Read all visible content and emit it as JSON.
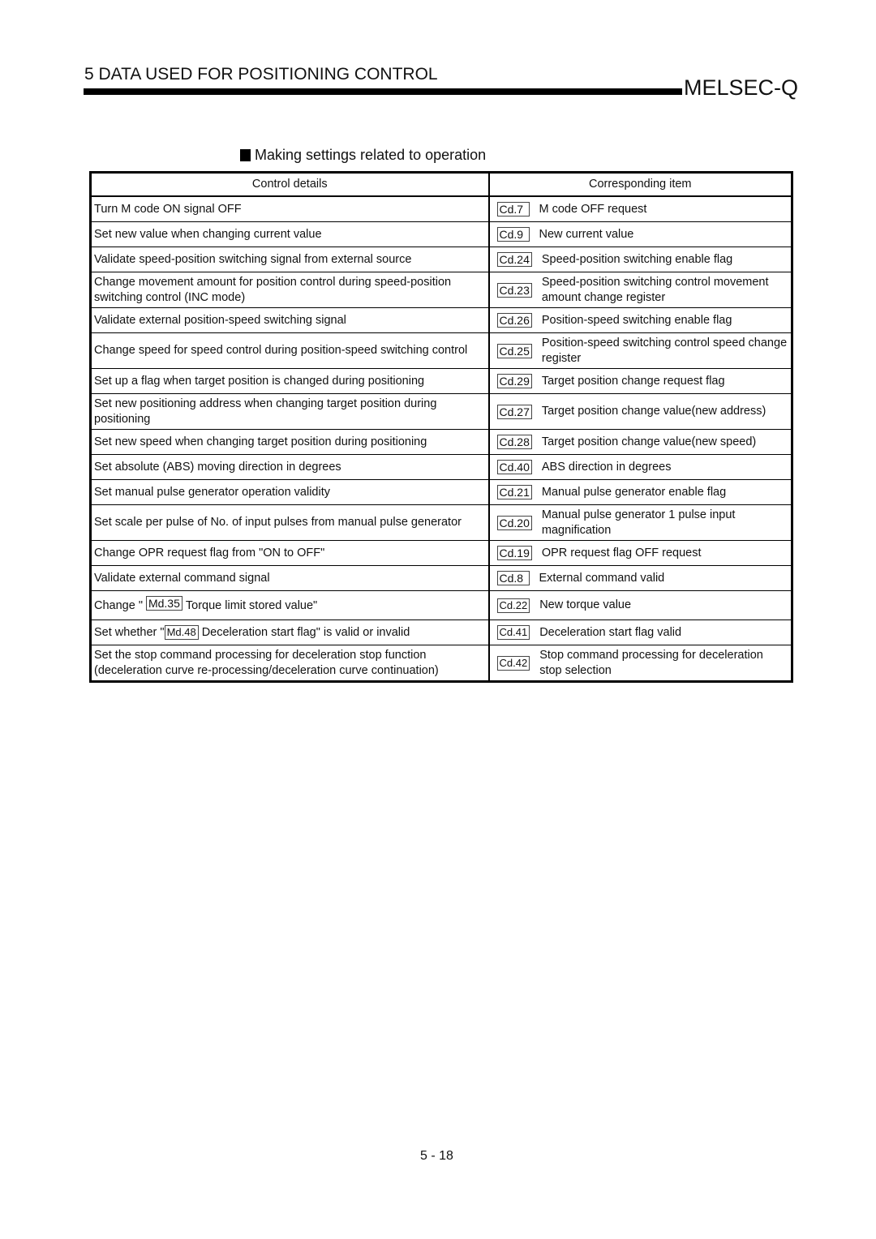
{
  "header": {
    "chapter_title": "5   DATA USED FOR POSITIONING CONTROL",
    "brand": "MELSEC-Q"
  },
  "section": {
    "title": "Making settings related to operation"
  },
  "table": {
    "headers": {
      "control_details": "Control details",
      "corresponding_item": "Corresponding item"
    },
    "rows": [
      {
        "detail": "Turn M code ON signal OFF",
        "code": "Cd.7",
        "item": "M code OFF request"
      },
      {
        "detail": "Set new value when changing current value",
        "code": "Cd.9",
        "item": "New current value"
      },
      {
        "detail": "Validate speed-position switching signal from external source",
        "code": "Cd.24",
        "item": "Speed-position switching enable flag"
      },
      {
        "detail": "Change movement amount for position control during speed-position switching control (INC mode)",
        "code": "Cd.23",
        "item": "Speed-position switching control movement amount change register"
      },
      {
        "detail": "Validate external position-speed switching signal",
        "code": "Cd.26",
        "item": "Position-speed switching enable flag"
      },
      {
        "detail": "Change speed for speed control during position-speed switching control",
        "code": "Cd.25",
        "item": "Position-speed switching control speed change register"
      },
      {
        "detail": "Set up a flag when target position is changed during positioning",
        "code": "Cd.29",
        "item": "Target position change request flag"
      },
      {
        "detail": "Set new positioning address when changing target position during positioning",
        "code": "Cd.27",
        "item": "Target position change value(new address)"
      },
      {
        "detail": "Set new speed when changing target position during positioning",
        "code": "Cd.28",
        "item": "Target position change value(new speed)"
      },
      {
        "detail": "Set absolute (ABS) moving direction in degrees",
        "code": "Cd.40",
        "item": "ABS direction in degrees"
      },
      {
        "detail": "Set manual pulse generator operation validity",
        "code": "Cd.21",
        "item": "Manual pulse generator enable flag"
      },
      {
        "detail": "Set scale per pulse of No. of input pulses from manual pulse generator",
        "code": "Cd.20",
        "item": "Manual pulse generator 1 pulse input magnification"
      },
      {
        "detail": "Change OPR request flag from \"ON to OFF\"",
        "code": "Cd.19",
        "item": "OPR request flag OFF request"
      },
      {
        "detail": "Validate external command signal",
        "code": "Cd.8",
        "item": "External command valid"
      },
      {
        "detail_prefix": "Change \"",
        "detail_code": "Md.35",
        "detail_suffix": "Torque limit stored value\"",
        "code": "Cd.22",
        "item": "New torque value"
      },
      {
        "detail_prefix": "Set whether \"",
        "detail_code": "Md.48",
        "detail_suffix": "Deceleration start flag\" is valid or invalid",
        "code": "Cd.41",
        "item": "Deceleration start flag valid"
      },
      {
        "detail": "Set the stop command processing for deceleration stop function (deceleration curve re-processing/deceleration curve continuation)",
        "code": "Cd.42",
        "item": "Stop command processing for deceleration stop selection"
      }
    ]
  },
  "footer": {
    "page_number": "5 - 18"
  }
}
